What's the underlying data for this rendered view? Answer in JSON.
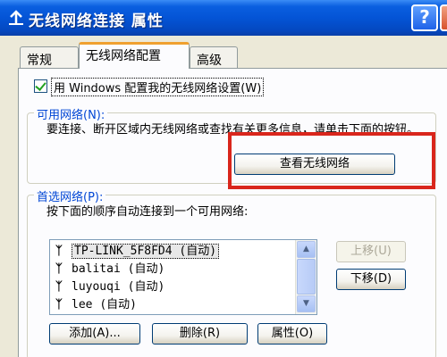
{
  "window": {
    "title": "无线网络连接 属性",
    "help_label": "?"
  },
  "tabs": [
    {
      "label": "常规"
    },
    {
      "label": "无线网络配置"
    },
    {
      "label": "高级"
    }
  ],
  "use_windows": {
    "label": "用 Windows 配置我的无线网络设置(W)",
    "checked": true
  },
  "available": {
    "title": "可用网络(N):",
    "description": "要连接、断开区域内无线网络或查找有关更多信息，请单击下面的按钮。",
    "view_button": "查看无线网络"
  },
  "preferred": {
    "title": "首选网络(P):",
    "description": "按下面的顺序自动连接到一个可用网络:",
    "networks": [
      {
        "name": "TP-LINK_5F8FD4",
        "mode": "(自动)",
        "selected": true
      },
      {
        "name": "balitai",
        "mode": "(自动)",
        "selected": false
      },
      {
        "name": "luyouqi",
        "mode": "(自动)",
        "selected": false
      },
      {
        "name": "lee",
        "mode": "(自动)",
        "selected": false
      }
    ],
    "move_up": "上移(U)",
    "move_down": "下移(D)",
    "add": "添加(A)...",
    "remove": "删除(R)",
    "properties": "属性(O)"
  },
  "colors": {
    "titlebar": "#0454d6",
    "highlight_box": "#d9261c",
    "group_title": "#0046d5"
  }
}
